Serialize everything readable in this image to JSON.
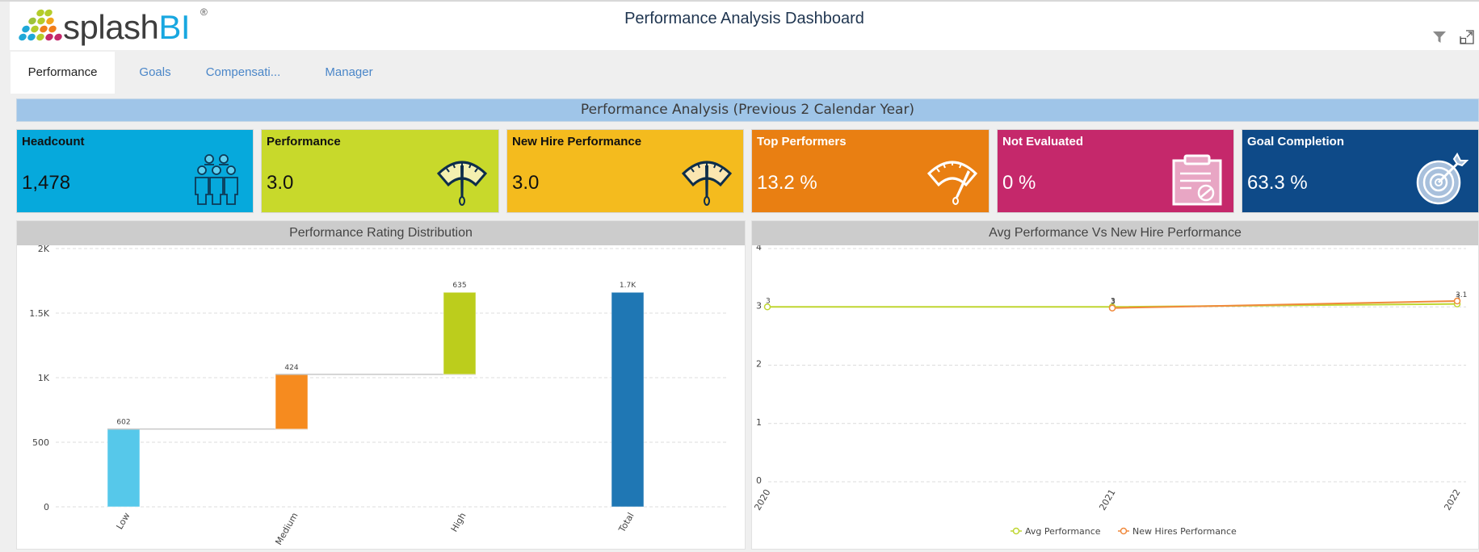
{
  "header": {
    "logo_text": "splash",
    "logo_text_accent": "BI",
    "logo_mark": "®",
    "title": "Performance Analysis Dashboard",
    "icons": [
      "filter-icon",
      "expand-icon"
    ]
  },
  "tabs": [
    {
      "label": "Performance",
      "active": true
    },
    {
      "label": "Goals",
      "active": false
    },
    {
      "label": "Compensati...",
      "active": false
    },
    {
      "label": "Manager",
      "active": false
    }
  ],
  "banner": "Performance Analysis (Previous 2 Calendar Year)",
  "kpis": [
    {
      "label": "Headcount",
      "value": "1,478",
      "color": "#06a9dc",
      "text_color": "#111111",
      "icon": "people-group-icon"
    },
    {
      "label": "Performance",
      "value": "3.0",
      "color": "#c8d92b",
      "text_color": "#111111",
      "icon": "gauge-icon"
    },
    {
      "label": "New Hire Performance",
      "value": "3.0",
      "color": "#f4bb1e",
      "text_color": "#111111",
      "icon": "gauge-icon"
    },
    {
      "label": "Top Performers",
      "value": "13.2 %",
      "color": "#e97f12",
      "text_color": "#ffffff",
      "icon": "speedometer-icon"
    },
    {
      "label": "Not Evaluated",
      "value": "0 %",
      "color": "#c5286b",
      "text_color": "#ffffff",
      "icon": "clipboard-icon"
    },
    {
      "label": "Goal Completion",
      "value": "63.3 %",
      "color": "#0e4a88",
      "text_color": "#ffffff",
      "icon": "target-icon"
    }
  ],
  "chart_data": [
    {
      "type": "bar",
      "subtype": "waterfall",
      "title": "Performance Rating Distribution",
      "categories": [
        "Low",
        "Medium",
        "High",
        "Total"
      ],
      "values": [
        602,
        424,
        635,
        1661
      ],
      "data_labels": [
        "602",
        "424",
        "635",
        "1.7K"
      ],
      "colors": [
        "#56c8ea",
        "#f68b1f",
        "#bccd1c",
        "#1f77b4"
      ],
      "yticks": [
        "0",
        "500",
        "1K",
        "1.5K",
        "2K"
      ],
      "ylim": [
        0,
        2000
      ],
      "grid": true,
      "xlabel": "",
      "ylabel": ""
    },
    {
      "type": "line",
      "title": "Avg Performance Vs New Hire Performance",
      "x": [
        "2020",
        "2021",
        "2022"
      ],
      "series": [
        {
          "name": "Avg Performance",
          "color": "#bfd630",
          "values": [
            3.0,
            3.0,
            3.05
          ],
          "labels": [
            "3",
            "3",
            "3"
          ]
        },
        {
          "name": "New Hires Performance",
          "color": "#f0893c",
          "values": [
            null,
            2.98,
            3.1
          ],
          "labels": [
            "",
            "3",
            "3.1"
          ]
        }
      ],
      "yticks": [
        "0",
        "1",
        "2",
        "3",
        "4"
      ],
      "ylim": [
        0,
        4
      ],
      "grid": true,
      "legend": "bottom-center"
    }
  ]
}
